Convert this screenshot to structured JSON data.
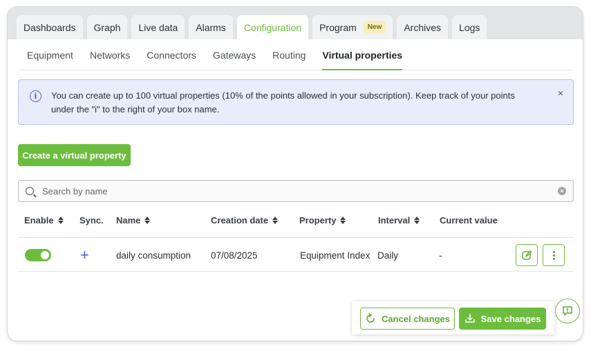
{
  "tabs": [
    {
      "label": "Dashboards"
    },
    {
      "label": "Graph"
    },
    {
      "label": "Live data"
    },
    {
      "label": "Alarms"
    },
    {
      "label": "Configuration",
      "active": true
    },
    {
      "label": "Program",
      "badge": "New"
    },
    {
      "label": "Archives"
    },
    {
      "label": "Logs"
    }
  ],
  "subtabs": [
    {
      "label": "Equipment"
    },
    {
      "label": "Networks"
    },
    {
      "label": "Connectors"
    },
    {
      "label": "Gateways"
    },
    {
      "label": "Routing"
    },
    {
      "label": "Virtual properties",
      "active": true
    }
  ],
  "info": {
    "icon": "info-circle-icon",
    "text": "You can create up to 100 virtual properties (10% of the points allowed in your subscription). Keep track of your points under the \"i\" to the right of your box name.",
    "close": "×"
  },
  "create_button": "Create a virtual property",
  "search": {
    "placeholder": "Search by name",
    "value": ""
  },
  "table": {
    "columns": {
      "enable": "Enable",
      "sync": "Sync.",
      "name": "Name",
      "creation_date": "Creation date",
      "property": "Property",
      "interval": "Interval",
      "current_value": "Current value"
    },
    "rows": [
      {
        "enabled": true,
        "sync": "+",
        "name": "daily consumption",
        "creation_date": "07/08/2025",
        "property": "Equipment Index",
        "interval": "Daily",
        "current_value": "-"
      }
    ]
  },
  "footer": {
    "cancel": "Cancel changes",
    "save": "Save changes"
  },
  "colors": {
    "accent": "#6cbd3d",
    "info_bg": "#e9edfb",
    "info_icon": "#4a63d6"
  }
}
